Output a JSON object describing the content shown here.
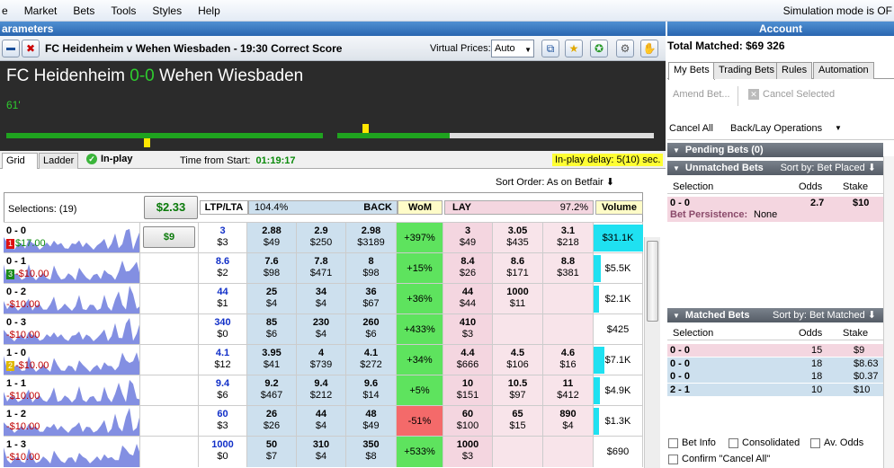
{
  "menu": {
    "items": [
      "e",
      "Market",
      "Bets",
      "Tools",
      "Styles",
      "Help"
    ],
    "sim_mode": "Simulation mode is OF"
  },
  "panels": {
    "left_title": "arameters",
    "right_title": "Account"
  },
  "toolbar": {
    "market_title": "FC Heidenheim v Wehen Wiesbaden - 19:30 Correct Score",
    "virtual_prices_label": "Virtual Prices:",
    "virtual_prices_value": "Auto"
  },
  "scoreboard": {
    "home": "FC Heidenheim",
    "score": "0-0",
    "away": "Wehen Wiesbaden",
    "minute": "61'"
  },
  "tabs": {
    "grid": "Grid",
    "ladder": "Ladder",
    "inplay": "In-play",
    "time_label": "Time from Start:",
    "time_value": "01:19:17",
    "delay": "In-play delay: 5(10) sec."
  },
  "sort": {
    "label": "Sort Order: As on Betfair ⬇"
  },
  "header": {
    "selections": "Selections: (19)",
    "big_price": "$2.33",
    "ltp_lta": "LTP/LTA",
    "back_pct": "104.4%",
    "back": "BACK",
    "wom": "WoM",
    "lay": "LAY",
    "lay_pct": "97.2%",
    "volume": "Volume"
  },
  "rows": [
    {
      "name": "0 - 0",
      "rank": "1",
      "rank_color": "#d11",
      "pl": "$17.00",
      "pl_pos": true,
      "stake_btn": "$9",
      "ltp": "3",
      "lta": "$3",
      "back": [
        [
          "2.88",
          "$49"
        ],
        [
          "2.9",
          "$250"
        ],
        [
          "2.98",
          "$3189"
        ]
      ],
      "wom": "+397%",
      "wom_neg": false,
      "lay": [
        [
          "3",
          "$49"
        ],
        [
          "3.05",
          "$435"
        ],
        [
          "3.1",
          "$218"
        ]
      ],
      "volume": "$31.1K",
      "vol_frac": 1.0
    },
    {
      "name": "0 - 1",
      "rank": "3",
      "rank_color": "#1a8a1a",
      "pl": "-$10.00",
      "pl_pos": false,
      "stake_btn": "",
      "ltp": "8.6",
      "lta": "$2",
      "back": [
        [
          "7.6",
          "$98"
        ],
        [
          "7.8",
          "$471"
        ],
        [
          "8",
          "$98"
        ]
      ],
      "wom": "+15%",
      "wom_neg": false,
      "lay": [
        [
          "8.4",
          "$26"
        ],
        [
          "8.6",
          "$171"
        ],
        [
          "8.8",
          "$381"
        ]
      ],
      "volume": "$5.5K",
      "vol_frac": 0.15
    },
    {
      "name": "0 - 2",
      "rank": "",
      "rank_color": "",
      "pl": "-$10.00",
      "pl_pos": false,
      "stake_btn": "",
      "ltp": "44",
      "lta": "$1",
      "back": [
        [
          "25",
          "$4"
        ],
        [
          "34",
          "$4"
        ],
        [
          "36",
          "$67"
        ]
      ],
      "wom": "+36%",
      "wom_neg": false,
      "lay": [
        [
          "44",
          "$44"
        ],
        [
          "1000",
          "$11"
        ],
        [
          "",
          ""
        ]
      ],
      "volume": "$2.1K",
      "vol_frac": 0.05
    },
    {
      "name": "0 - 3",
      "rank": "",
      "rank_color": "",
      "pl": "-$10.00",
      "pl_pos": false,
      "stake_btn": "",
      "ltp": "340",
      "lta": "$0",
      "back": [
        [
          "85",
          "$6"
        ],
        [
          "230",
          "$4"
        ],
        [
          "260",
          "$6"
        ]
      ],
      "wom": "+433%",
      "wom_neg": false,
      "lay": [
        [
          "410",
          "$3"
        ],
        [
          "",
          ""
        ],
        [
          "",
          ""
        ]
      ],
      "volume": "$425",
      "vol_frac": 0.0
    },
    {
      "name": "1 - 0",
      "rank": "2",
      "rank_color": "#e0b800",
      "pl": "-$10.00",
      "pl_pos": false,
      "stake_btn": "",
      "ltp": "4.1",
      "lta": "$12",
      "back": [
        [
          "3.95",
          "$41"
        ],
        [
          "4",
          "$739"
        ],
        [
          "4.1",
          "$272"
        ]
      ],
      "wom": "+34%",
      "wom_neg": false,
      "lay": [
        [
          "4.4",
          "$666"
        ],
        [
          "4.5",
          "$106"
        ],
        [
          "4.6",
          "$16"
        ]
      ],
      "volume": "$7.1K",
      "vol_frac": 0.22
    },
    {
      "name": "1 - 1",
      "rank": "",
      "rank_color": "",
      "pl": "-$10.00",
      "pl_pos": false,
      "stake_btn": "",
      "ltp": "9.4",
      "lta": "$6",
      "back": [
        [
          "9.2",
          "$467"
        ],
        [
          "9.4",
          "$212"
        ],
        [
          "9.6",
          "$14"
        ]
      ],
      "wom": "+5%",
      "wom_neg": false,
      "lay": [
        [
          "10",
          "$151"
        ],
        [
          "10.5",
          "$97"
        ],
        [
          "11",
          "$412"
        ]
      ],
      "volume": "$4.9K",
      "vol_frac": 0.13
    },
    {
      "name": "1 - 2",
      "rank": "",
      "rank_color": "",
      "pl": "-$10.00",
      "pl_pos": false,
      "stake_btn": "",
      "ltp": "60",
      "lta": "$3",
      "back": [
        [
          "26",
          "$26"
        ],
        [
          "44",
          "$4"
        ],
        [
          "48",
          "$49"
        ]
      ],
      "wom": "-51%",
      "wom_neg": true,
      "lay": [
        [
          "60",
          "$100"
        ],
        [
          "65",
          "$15"
        ],
        [
          "890",
          "$4"
        ]
      ],
      "volume": "$1.3K",
      "vol_frac": 0.03
    },
    {
      "name": "1 - 3",
      "rank": "",
      "rank_color": "",
      "pl": "-$10.00",
      "pl_pos": false,
      "stake_btn": "",
      "ltp": "1000",
      "lta": "$0",
      "back": [
        [
          "50",
          "$7"
        ],
        [
          "310",
          "$4"
        ],
        [
          "350",
          "$8"
        ]
      ],
      "wom": "+533%",
      "wom_neg": false,
      "lay": [
        [
          "1000",
          "$3"
        ],
        [
          "",
          ""
        ],
        [
          "",
          ""
        ]
      ],
      "volume": "$690",
      "vol_frac": 0.0
    }
  ],
  "right": {
    "total_matched": "Total Matched: $69 326",
    "tabs": [
      "My Bets",
      "Trading Bets",
      "Rules",
      "Automation"
    ],
    "amend": "Amend Bet...",
    "cancel_selected": "Cancel Selected",
    "cancel_all": "Cancel All",
    "backlay_ops": "Back/Lay Operations",
    "pending": "Pending Bets (0)",
    "unmatched": "Unmatched Bets",
    "unmatched_sort": "Sort by: Bet Placed ⬇",
    "col_selection": "Selection",
    "col_odds": "Odds",
    "col_stake": "Stake",
    "unmatched_rows": [
      {
        "sel": "0 - 0",
        "odds": "2.7",
        "stake": "$10"
      }
    ],
    "persistence_label": "Bet Persistence:",
    "persistence_value": "None",
    "matched": "Matched Bets",
    "matched_sort": "Sort by: Bet Matched ⬇",
    "matched_rows": [
      {
        "sel": "0 - 0",
        "odds": "15",
        "stake": "$9",
        "side": "lay"
      },
      {
        "sel": "0 - 0",
        "odds": "18",
        "stake": "$8.63",
        "side": "back"
      },
      {
        "sel": "0 - 0",
        "odds": "18",
        "stake": "$0.37",
        "side": "back"
      },
      {
        "sel": "2 - 1",
        "odds": "10",
        "stake": "$10",
        "side": "back"
      }
    ],
    "opts": [
      "Bet Info",
      "Consolidated",
      "Av. Odds",
      "Confirm \"Cancel All\""
    ]
  }
}
